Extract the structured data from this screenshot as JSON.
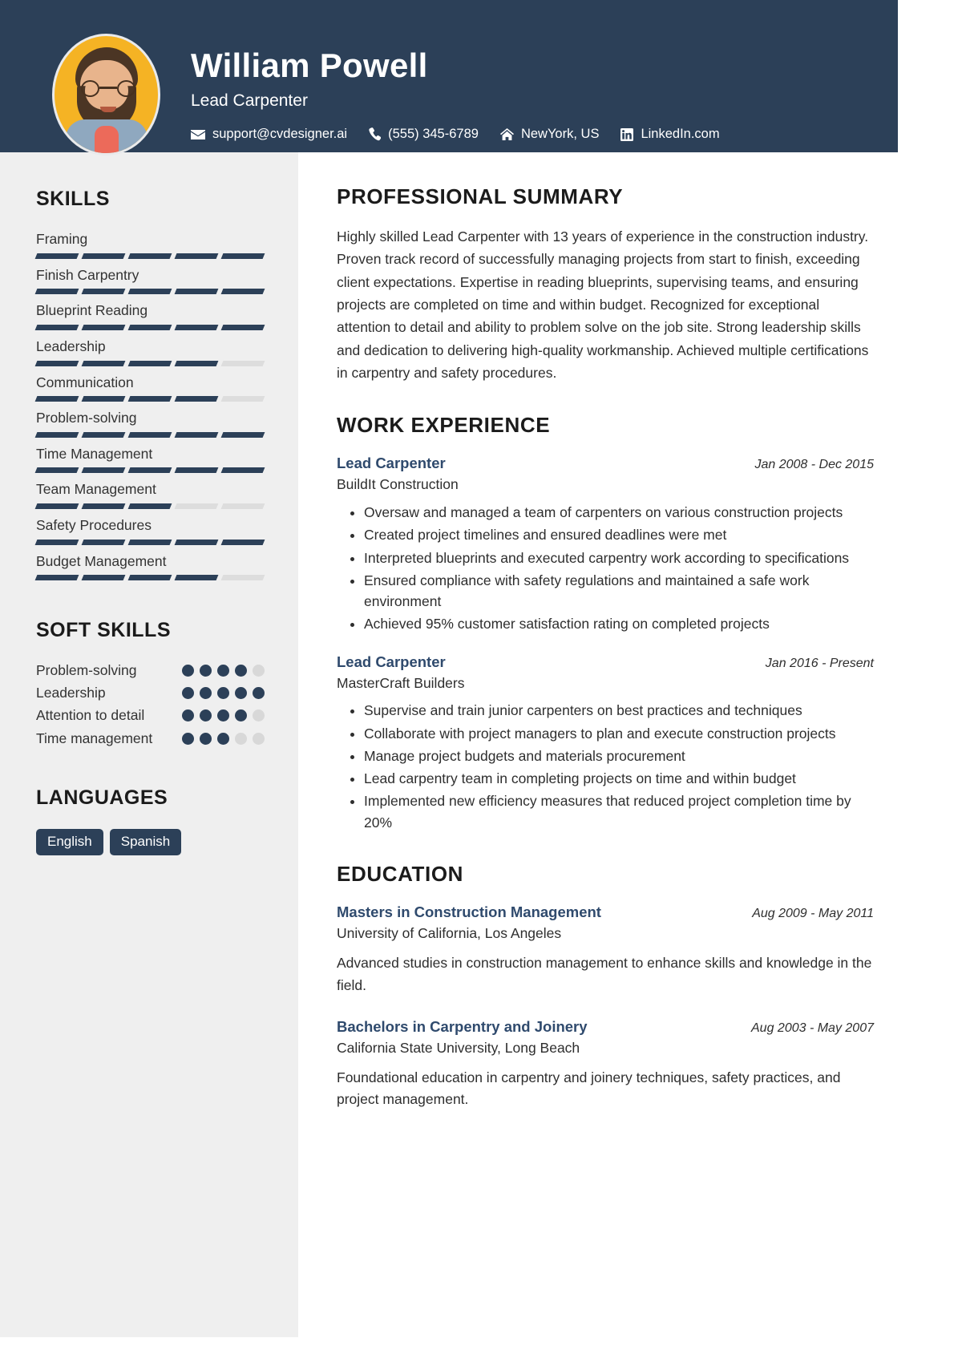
{
  "header": {
    "name": "William Powell",
    "role": "Lead Carpenter",
    "contacts": [
      {
        "icon": "envelope-icon",
        "text": "support@cvdesigner.ai"
      },
      {
        "icon": "phone-icon",
        "text": "(555) 345-6789"
      },
      {
        "icon": "home-icon",
        "text": "NewYork, US"
      },
      {
        "icon": "linkedin-icon",
        "text": "LinkedIn.com"
      }
    ],
    "avatar_alt": "profile-photo",
    "background_color": "#2c4058",
    "avatar_background": "#f5b324"
  },
  "sidebar": {
    "skills_heading": "SKILLS",
    "skills": [
      {
        "name": "Framing",
        "level": 5,
        "max": 5
      },
      {
        "name": "Finish Carpentry",
        "level": 5,
        "max": 5
      },
      {
        "name": "Blueprint Reading",
        "level": 5,
        "max": 5
      },
      {
        "name": "Leadership",
        "level": 4,
        "max": 5
      },
      {
        "name": "Communication",
        "level": 4,
        "max": 5
      },
      {
        "name": "Problem-solving",
        "level": 5,
        "max": 5
      },
      {
        "name": "Time Management",
        "level": 5,
        "max": 5
      },
      {
        "name": "Team Management",
        "level": 3,
        "max": 5
      },
      {
        "name": "Safety Procedures",
        "level": 5,
        "max": 5
      },
      {
        "name": "Budget Management",
        "level": 4,
        "max": 5
      }
    ],
    "soft_skills_heading": "SOFT SKILLS",
    "soft_skills": [
      {
        "name": "Problem-solving",
        "level": 4,
        "max": 5
      },
      {
        "name": "Leadership",
        "level": 5,
        "max": 5
      },
      {
        "name": "Attention to detail",
        "level": 4,
        "max": 5
      },
      {
        "name": "Time management",
        "level": 3,
        "max": 5
      }
    ],
    "languages_heading": "LANGUAGES",
    "languages": [
      "English",
      "Spanish"
    ],
    "accent_color": "#2c4058",
    "muted_color": "#dddddd",
    "background_color": "#efefef"
  },
  "main": {
    "summary_heading": "PROFESSIONAL SUMMARY",
    "summary_text": "Highly skilled Lead Carpenter with 13 years of experience in the construction industry. Proven track record of successfully managing projects from start to finish, exceeding client expectations. Expertise in reading blueprints, supervising teams, and ensuring projects are completed on time and within budget. Recognized for exceptional attention to detail and ability to problem solve on the job site. Strong leadership skills and dedication to delivering high-quality workmanship. Achieved multiple certifications in carpentry and safety procedures.",
    "experience_heading": "WORK EXPERIENCE",
    "experience": [
      {
        "title": "Lead Carpenter",
        "company": "BuildIt Construction",
        "date": "Jan 2008 - Dec 2015",
        "bullets": [
          "Oversaw and managed a team of carpenters on various construction projects",
          "Created project timelines and ensured deadlines were met",
          "Interpreted blueprints and executed carpentry work according to specifications",
          "Ensured compliance with safety regulations and maintained a safe work environment",
          "Achieved 95% customer satisfaction rating on completed projects"
        ]
      },
      {
        "title": "Lead Carpenter",
        "company": "MasterCraft Builders",
        "date": "Jan 2016 - Present",
        "bullets": [
          "Supervise and train junior carpenters on best practices and techniques",
          "Collaborate with project managers to plan and execute construction projects",
          "Manage project budgets and materials procurement",
          "Lead carpentry team in completing projects on time and within budget",
          "Implemented new efficiency measures that reduced project completion time by 20%"
        ]
      }
    ],
    "education_heading": "EDUCATION",
    "education": [
      {
        "degree": "Masters in Construction Management",
        "school": "University of California, Los Angeles",
        "date": "Aug 2009 - May 2011",
        "description": "Advanced studies in construction management to enhance skills and knowledge in the field."
      },
      {
        "degree": "Bachelors in Carpentry and Joinery",
        "school": "California State University, Long Beach",
        "date": "Aug 2003 - May 2007",
        "description": "Foundational education in carpentry and joinery techniques, safety practices, and project management."
      }
    ],
    "title_color": "#2f4a6d"
  }
}
